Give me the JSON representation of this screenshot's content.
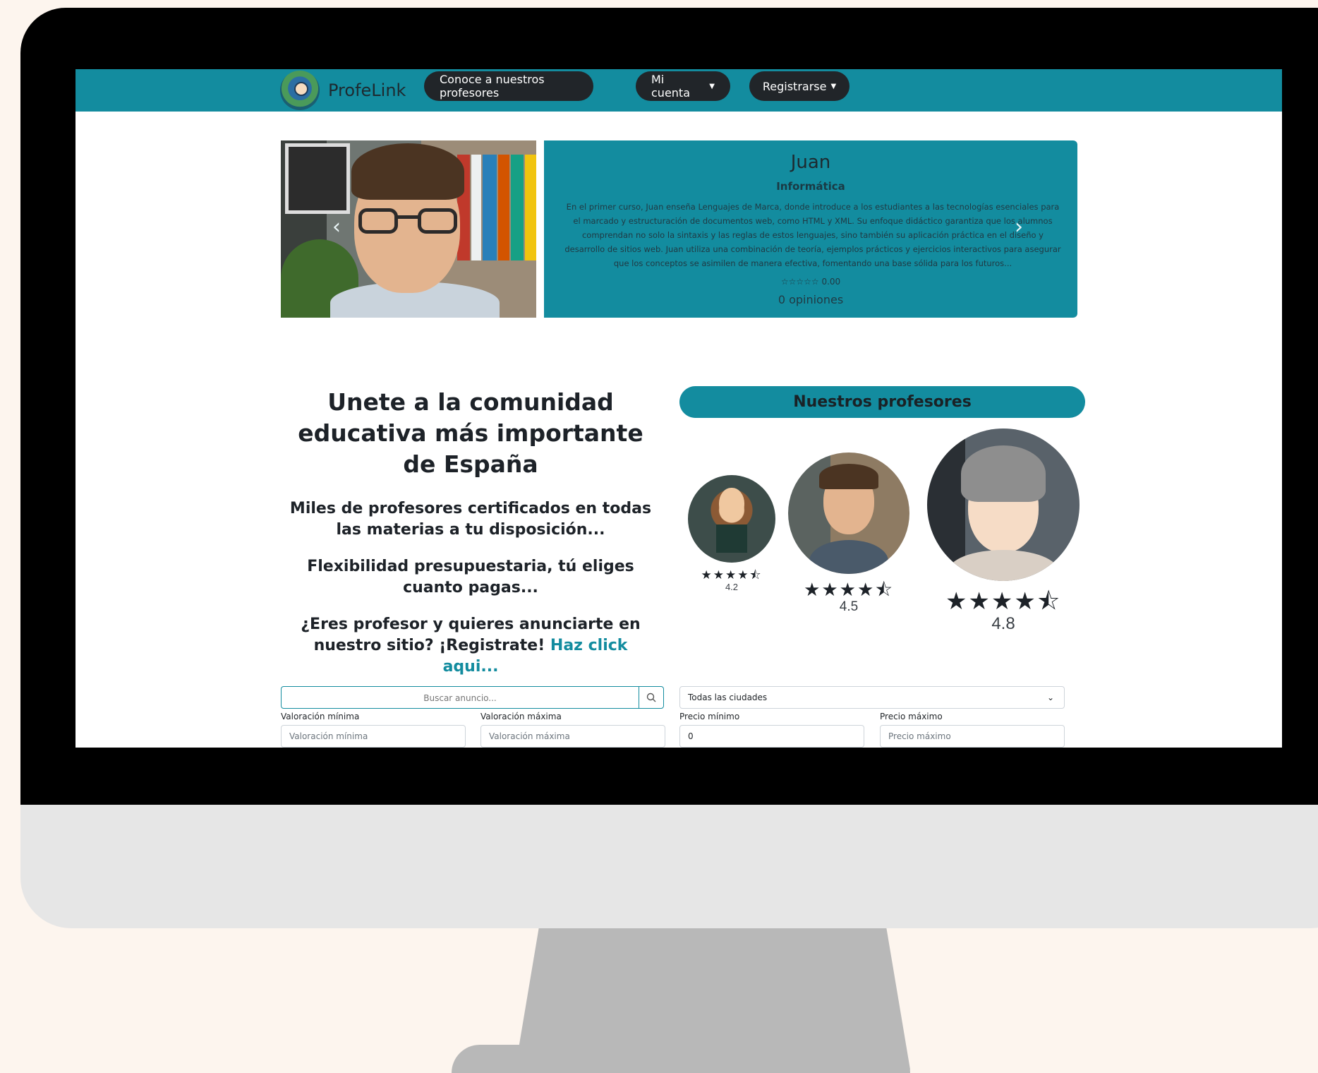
{
  "nav": {
    "brand": "ProfeLink",
    "buttons": [
      {
        "label": "Conoce a nuestros profesores"
      },
      {
        "label": "Mi cuenta"
      },
      {
        "label": "Registrarse"
      }
    ]
  },
  "carousel": {
    "name": "Juan",
    "subject": "Informática",
    "description": "En el primer curso, Juan enseña Lenguajes de Marca, donde introduce a los estudiantes a las tecnologías esenciales para el marcado y estructuración de documentos web, como HTML y XML. Su enfoque didáctico garantiza que los alumnos comprendan no solo la sintaxis y las reglas de estos lenguajes, sino también su aplicación práctica en el diseño y desarrollo de sitios web. Juan utiliza una combinación de teoría, ejemplos prácticos y ejercicios interactivos para asegurar que los conceptos se asimilen de manera efectiva, fomentando una base sólida para los futuros...",
    "rating_value": "0.00",
    "reviews": "0 opiniones",
    "prev_symbol": "‹",
    "next_symbol": "›"
  },
  "promo": {
    "title": "Unete a la comunidad educativa más importante de España",
    "line1": "Miles de profesores certificados en todas las materias a tu disposición...",
    "line2": "Flexibilidad presupuestaria, tú eliges cuanto pagas...",
    "line3_text": "¿Eres profesor y quieres anunciarte en nuestro sitio? ¡Registrate!",
    "line3_link": "Haz click aqui..."
  },
  "professors": {
    "header": "Nuestros profesores",
    "items": [
      {
        "score": "4.2",
        "rating": 4.2
      },
      {
        "score": "4.5",
        "rating": 4.5
      },
      {
        "score": "4.8",
        "rating": 4.8
      }
    ]
  },
  "filters": {
    "search_placeholder": "Buscar anuncio...",
    "city_selected": "Todas las ciudades",
    "min_rating_label": "Valoración mínima",
    "min_rating_placeholder": "Valoración mínima",
    "max_rating_label": "Valoración máxima",
    "max_rating_placeholder": "Valoración máxima",
    "min_price_label": "Precio mínimo",
    "min_price_value": "0",
    "max_price_label": "Precio máximo",
    "max_price_placeholder": "Precio máximo"
  },
  "colors": {
    "accent": "#138c9f",
    "dark_button": "#212529"
  }
}
